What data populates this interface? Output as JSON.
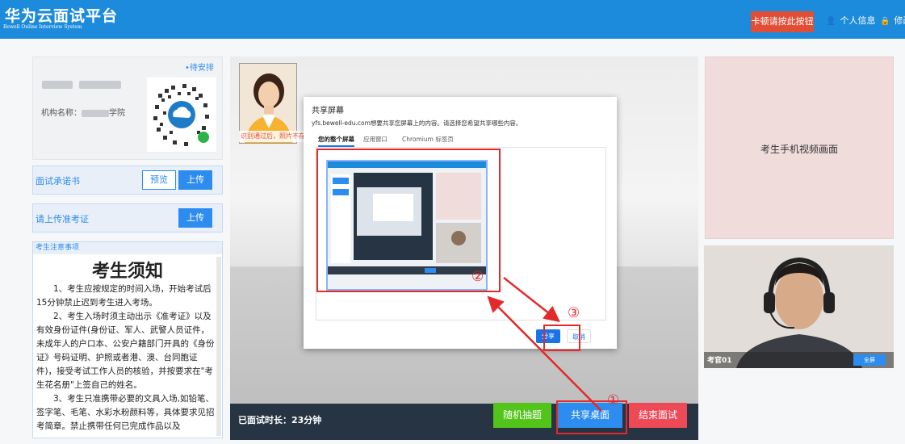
{
  "header": {
    "title": "华为云面试平台",
    "subtitle": "Bewell Online Interview System",
    "help_button": "卡顿请按此按钮",
    "profile_label": "个人信息",
    "edit_label": "修改"
  },
  "left": {
    "pending_tag": "•待安排",
    "org_label": "机构名称：",
    "org_suffix": "学院",
    "commitment_label": "面试承诺书",
    "preview_button": "预览",
    "upload_button": "上传",
    "admit_label": "请上传准考证",
    "admit_upload_button": "上传",
    "notice_heading": "考生注意事项",
    "notice_title": "考生须知",
    "notice_p1": "1、考生应按规定的时间入场，开始考试后15分钟禁止迟到考生进入考场。",
    "notice_p2": "2、考生入场时须主动出示《准考证》以及有效身份证件(身份证、军人、武警人员证件，未成年人的户口本、公安户籍部门开具的《身份证》号码证明、护照或者港、澳、台同胞证件)，接受考试工作人员的核验，并按要求在\"考生花名册\"上签自己的姓名。",
    "notice_p3": "3、考生只准携带必要的文具入场,如铅笔、签字笔、毛笔、水彩水粉颜料等，具体要求见招考简章。禁止携带任何已完成作品以及"
  },
  "video": {
    "face_label": "识别通过后，照片不存",
    "elapsed": "已面试时长：23分钟",
    "random_button": "随机抽题",
    "share_desktop_button": "共享桌面",
    "end_button": "结束面试"
  },
  "dialog": {
    "title": "共享屏幕",
    "description": "yfs.bewell-edu.com想要共享您屏幕上的内容。请选择您希望共享哪些内容。",
    "tabs": [
      "您的整个屏幕",
      "应用窗口",
      "Chromium 标签页"
    ],
    "share_button": "分享",
    "cancel_button": "取消"
  },
  "annotations": {
    "step1": "①",
    "step2": "②",
    "step3": "③"
  },
  "right": {
    "phone_video_label": "考生手机视频画面",
    "examiner_name": "考官01",
    "fullscreen_button": "全屏"
  },
  "colors": {
    "header_blue": "#1c8bdc",
    "help_red": "#e14e36",
    "random_green": "#52c41a",
    "share_blue": "#2d8cf0",
    "end_red": "#ed4956",
    "annotation_red": "#e32a2a"
  }
}
